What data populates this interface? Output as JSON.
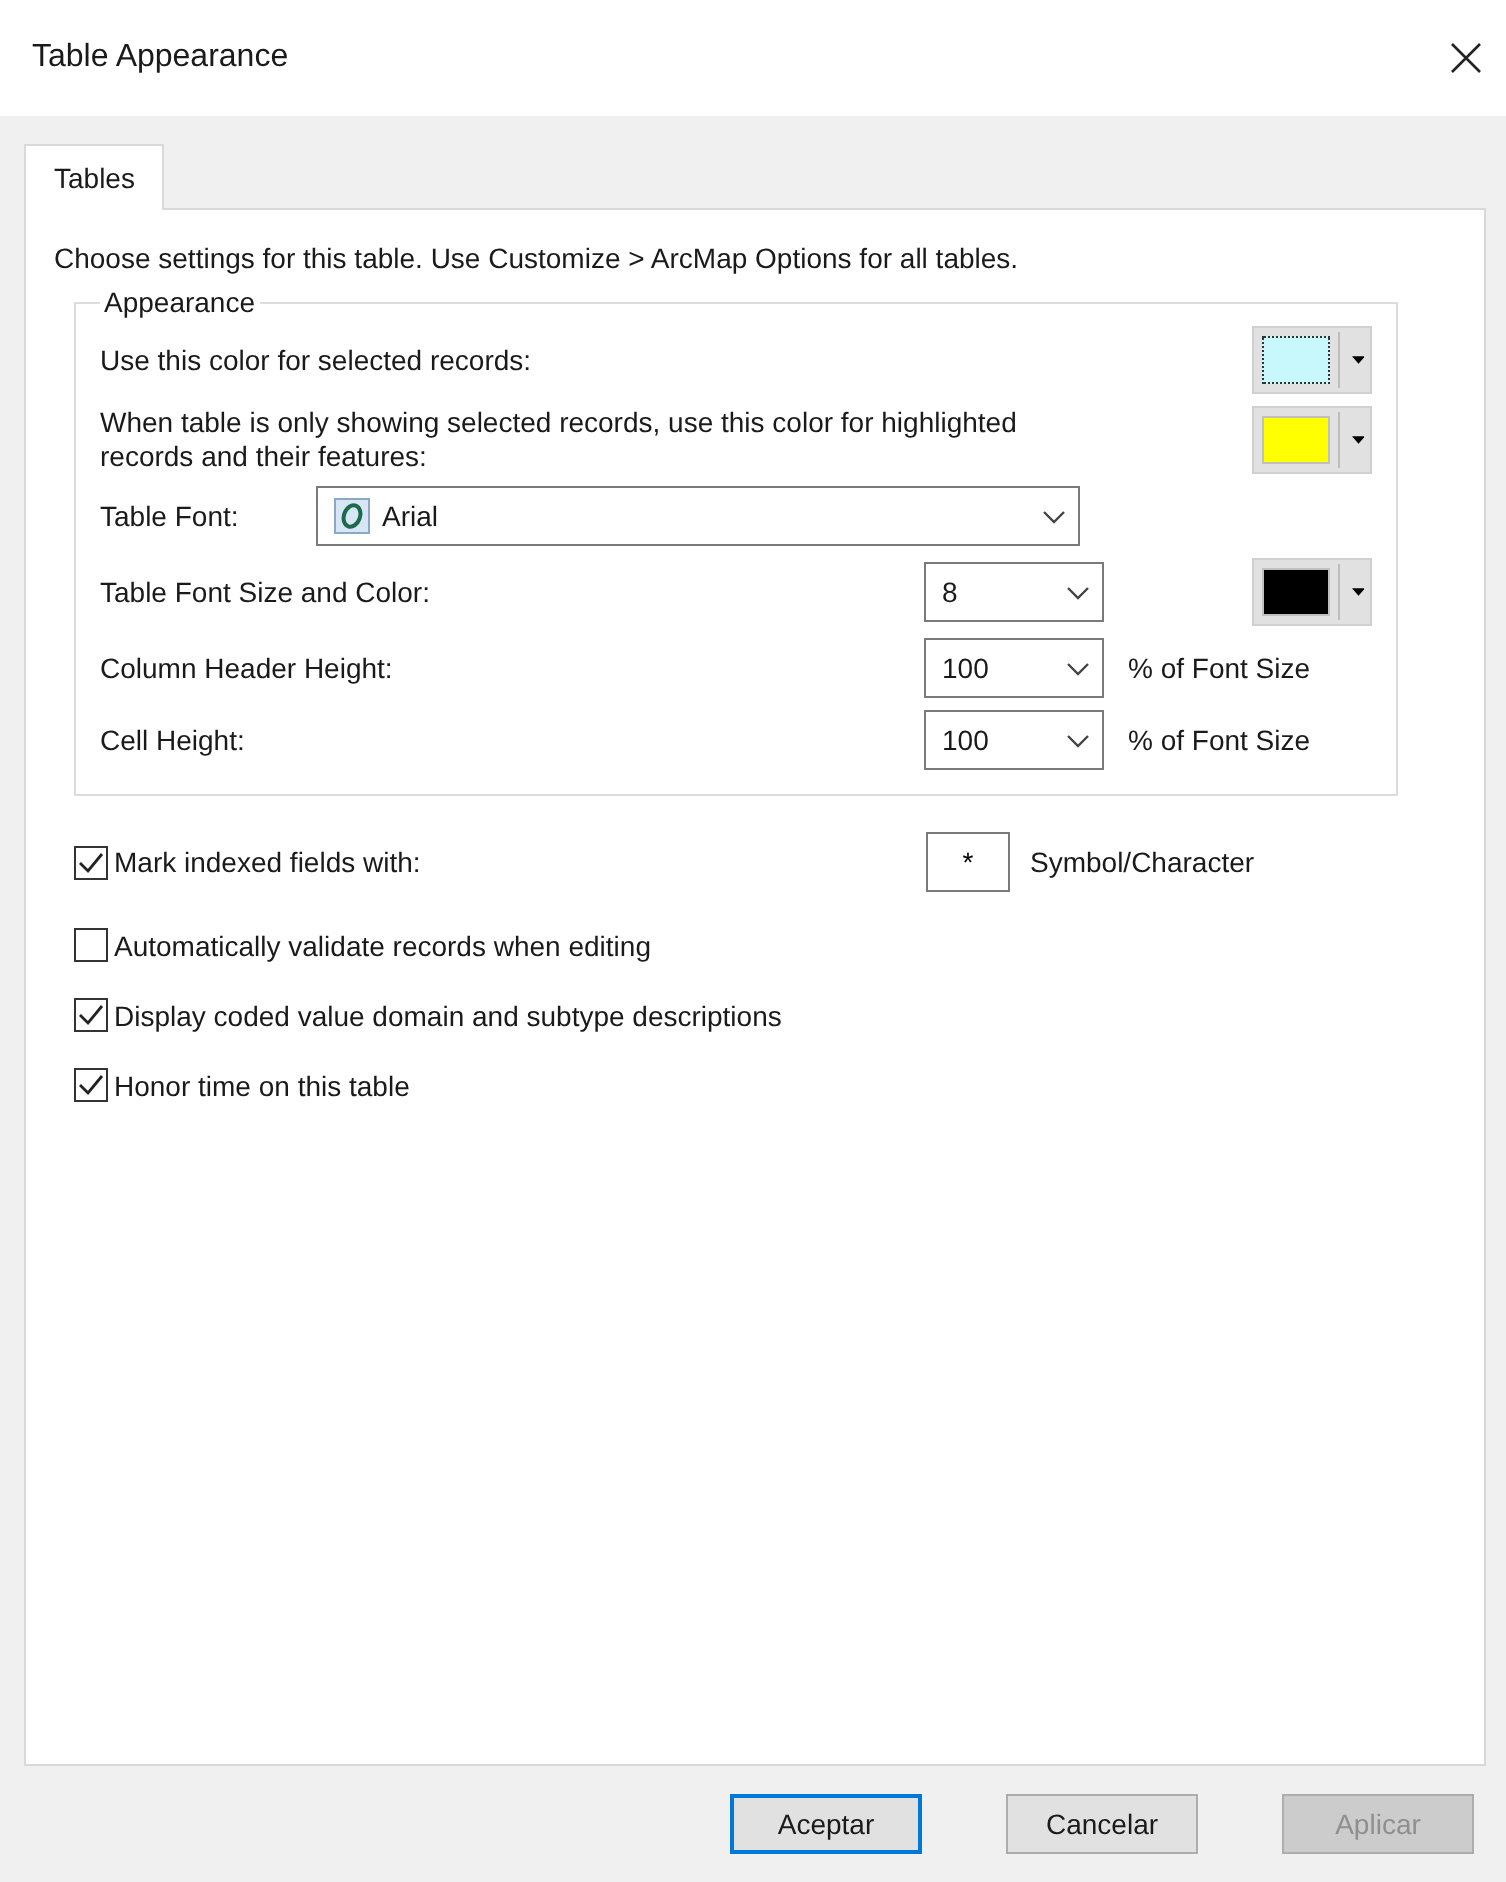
{
  "window": {
    "title": "Table Appearance"
  },
  "tabs": [
    {
      "label": "Tables",
      "selected": true
    }
  ],
  "intro": "Choose settings for this table. Use Customize > ArcMap Options for all tables.",
  "appearance": {
    "title": "Appearance",
    "color_rows": [
      {
        "label": "Use this color for selected records:",
        "color": "#c8f8fc",
        "focused": true
      },
      {
        "label": "When table is only showing selected records, use this color for highlighted records and their features:",
        "color": "#ffff00",
        "focused": false
      }
    ],
    "font": {
      "label": "Table Font:",
      "value": "Arial"
    },
    "size_rows": [
      {
        "kind": "color",
        "label": "Table Font Size and Color:",
        "value": "8",
        "color": "#000000"
      },
      {
        "kind": "percent",
        "label": "Column Header Height:",
        "value": "100",
        "suffix": "% of Font Size"
      },
      {
        "kind": "percent",
        "label": "Cell Height:",
        "value": "100",
        "suffix": "% of Font Size"
      }
    ]
  },
  "options": [
    {
      "label": "Mark indexed fields with:",
      "checked": true,
      "symbol": "*",
      "symbol_label": "Symbol/Character"
    },
    {
      "label": "Automatically validate records when editing",
      "checked": false
    },
    {
      "label": "Display coded value domain and subtype descriptions",
      "checked": true
    },
    {
      "label": "Honor time on this table",
      "checked": true
    }
  ],
  "buttons": [
    {
      "label": "Aceptar",
      "default": true,
      "disabled": false
    },
    {
      "label": "Cancelar",
      "default": false,
      "disabled": false
    },
    {
      "label": "Aplicar",
      "default": false,
      "disabled": true
    }
  ]
}
